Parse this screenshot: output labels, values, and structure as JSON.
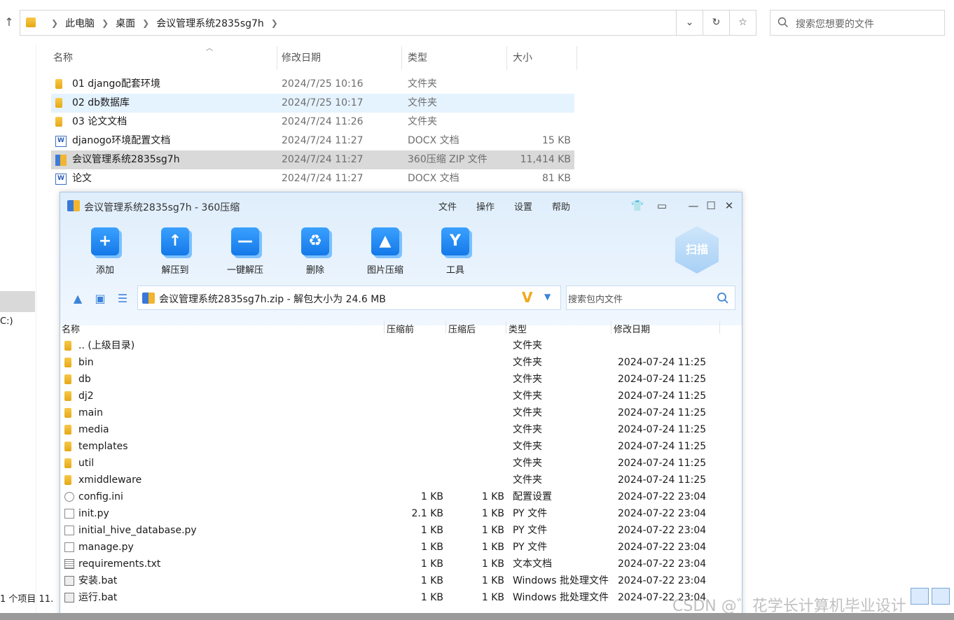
{
  "explorer": {
    "breadcrumbs": [
      "此电脑",
      "桌面",
      "会议管理系统2835sg7h"
    ],
    "search_placeholder": "搜索您想要的文件",
    "columns": {
      "name": "名称",
      "date": "修改日期",
      "type": "类型",
      "size": "大小"
    },
    "files": [
      {
        "name": "01 django配套环境",
        "date": "2024/7/25 10:16",
        "type": "文件夹",
        "size": "",
        "icon": "folder-icon"
      },
      {
        "name": "02 db数据库",
        "date": "2024/7/25 10:17",
        "type": "文件夹",
        "size": "",
        "icon": "folder-icon"
      },
      {
        "name": "03 论文文档",
        "date": "2024/7/24 11:26",
        "type": "文件夹",
        "size": "",
        "icon": "folder-icon"
      },
      {
        "name": "djanogo环境配置文档",
        "date": "2024/7/24 11:27",
        "type": "DOCX 文档",
        "size": "15 KB",
        "icon": "word-doc-icon"
      },
      {
        "name": "会议管理系统2835sg7h",
        "date": "2024/7/24 11:27",
        "type": "360压缩 ZIP 文件",
        "size": "11,414 KB",
        "icon": "zip-archive-icon"
      },
      {
        "name": "论文",
        "date": "2024/7/24 11:27",
        "type": "DOCX 文档",
        "size": "81 KB",
        "icon": "word-doc-icon"
      }
    ],
    "left_drive_label": "C:)",
    "status_text": "1 个项目  11."
  },
  "zip": {
    "title": "会议管理系统2835sg7h - 360压缩",
    "menu": [
      "文件",
      "操作",
      "设置",
      "帮助"
    ],
    "tools": [
      {
        "label": "添加",
        "glyph": "+"
      },
      {
        "label": "解压到",
        "glyph": "↑"
      },
      {
        "label": "一键解压",
        "glyph": "—"
      },
      {
        "label": "删除",
        "glyph": "♻"
      },
      {
        "label": "图片压缩",
        "glyph": "▲"
      },
      {
        "label": "工具",
        "glyph": "Y"
      }
    ],
    "scan_label": "扫描",
    "path": "会议管理系统2835sg7h.zip - 解包大小为 24.6 MB",
    "search_placeholder": "搜索包内文件",
    "columns": {
      "name": "名称",
      "before": "压缩前",
      "after": "压缩后",
      "type": "类型",
      "date": "修改日期"
    },
    "entries": [
      {
        "name": ".. (上级目录)",
        "before": "",
        "after": "",
        "type": "文件夹",
        "date": "",
        "icon": "folder-icon"
      },
      {
        "name": "bin",
        "before": "",
        "after": "",
        "type": "文件夹",
        "date": "2024-07-24 11:25",
        "icon": "folder-icon"
      },
      {
        "name": "db",
        "before": "",
        "after": "",
        "type": "文件夹",
        "date": "2024-07-24 11:25",
        "icon": "folder-icon"
      },
      {
        "name": "dj2",
        "before": "",
        "after": "",
        "type": "文件夹",
        "date": "2024-07-24 11:25",
        "icon": "folder-icon"
      },
      {
        "name": "main",
        "before": "",
        "after": "",
        "type": "文件夹",
        "date": "2024-07-24 11:25",
        "icon": "folder-icon"
      },
      {
        "name": "media",
        "before": "",
        "after": "",
        "type": "文件夹",
        "date": "2024-07-24 11:25",
        "icon": "folder-icon"
      },
      {
        "name": "templates",
        "before": "",
        "after": "",
        "type": "文件夹",
        "date": "2024-07-24 11:25",
        "icon": "folder-icon"
      },
      {
        "name": "util",
        "before": "",
        "after": "",
        "type": "文件夹",
        "date": "2024-07-24 11:25",
        "icon": "folder-icon"
      },
      {
        "name": "xmiddleware",
        "before": "",
        "after": "",
        "type": "文件夹",
        "date": "2024-07-24 11:25",
        "icon": "folder-icon"
      },
      {
        "name": "config.ini",
        "before": "1 KB",
        "after": "1 KB",
        "type": "配置设置",
        "date": "2024-07-22 23:04",
        "icon": "config-file-icon"
      },
      {
        "name": "init.py",
        "before": "2.1 KB",
        "after": "1 KB",
        "type": "PY 文件",
        "date": "2024-07-22 23:04",
        "icon": "file-icon"
      },
      {
        "name": "initial_hive_database.py",
        "before": "1 KB",
        "after": "1 KB",
        "type": "PY 文件",
        "date": "2024-07-22 23:04",
        "icon": "file-icon"
      },
      {
        "name": "manage.py",
        "before": "1 KB",
        "after": "1 KB",
        "type": "PY 文件",
        "date": "2024-07-22 23:04",
        "icon": "file-icon"
      },
      {
        "name": "requirements.txt",
        "before": "1 KB",
        "after": "1 KB",
        "type": "文本文档",
        "date": "2024-07-22 23:04",
        "icon": "text-file-icon"
      },
      {
        "name": "安装.bat",
        "before": "1 KB",
        "after": "1 KB",
        "type": "Windows 批处理文件",
        "date": "2024-07-22 23:04",
        "icon": "batch-file-icon"
      },
      {
        "name": "运行.bat",
        "before": "1 KB",
        "after": "1 KB",
        "type": "Windows 批处理文件",
        "date": "2024-07-22 23:04",
        "icon": "batch-file-icon"
      }
    ]
  },
  "watermark": "CSDN @゛花学长计算机毕业设计"
}
